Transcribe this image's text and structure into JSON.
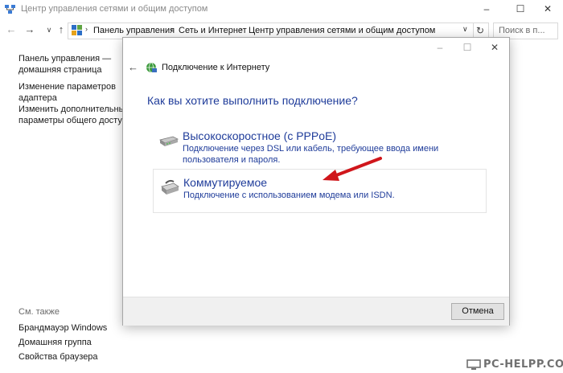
{
  "window": {
    "title": "Центр управления сетями и общим доступом",
    "controls": {
      "minimize": "–",
      "maximize": "☐",
      "close": "✕"
    }
  },
  "nav": {
    "back": "←",
    "forward": "→",
    "history": "∨",
    "up": "↑",
    "breadcrumbs": [
      "Панель управления",
      "Сеть и Интернет",
      "Центр управления сетями и общим доступом"
    ],
    "separator": "›",
    "dropdown": "∨",
    "refresh": "↻",
    "search_placeholder": "Поиск в п..."
  },
  "sidebar": {
    "links": [
      {
        "label_1": "Панель управления —",
        "label_2": "домашняя страница"
      },
      {
        "label_1": "Изменение параметров",
        "label_2": "адаптера"
      },
      {
        "label_1": "Изменить дополнительные",
        "label_2": "параметры общего доступа"
      }
    ],
    "see_also": "См. также",
    "see_also_links": [
      "Брандмауэр Windows",
      "Домашняя группа",
      "Свойства браузера"
    ]
  },
  "dialog": {
    "title": "Подключение к Интернету",
    "heading": "Как вы хотите выполнить подключение?",
    "options": [
      {
        "title": "Высокоскоростное (с PPPoE)",
        "description": "Подключение через DSL или кабель, требующее ввода имени пользователя и пароля."
      },
      {
        "title": "Коммутируемое",
        "description": "Подключение с использованием модема или ISDN."
      }
    ],
    "cancel_label": "Отмена",
    "controls": {
      "minimize": "–",
      "maximize": "☐",
      "close": "✕"
    }
  },
  "annotation_arrow_color": "#d0161b",
  "accent_color": "#1f3c9a",
  "watermark": "PC-HELPP.COM"
}
